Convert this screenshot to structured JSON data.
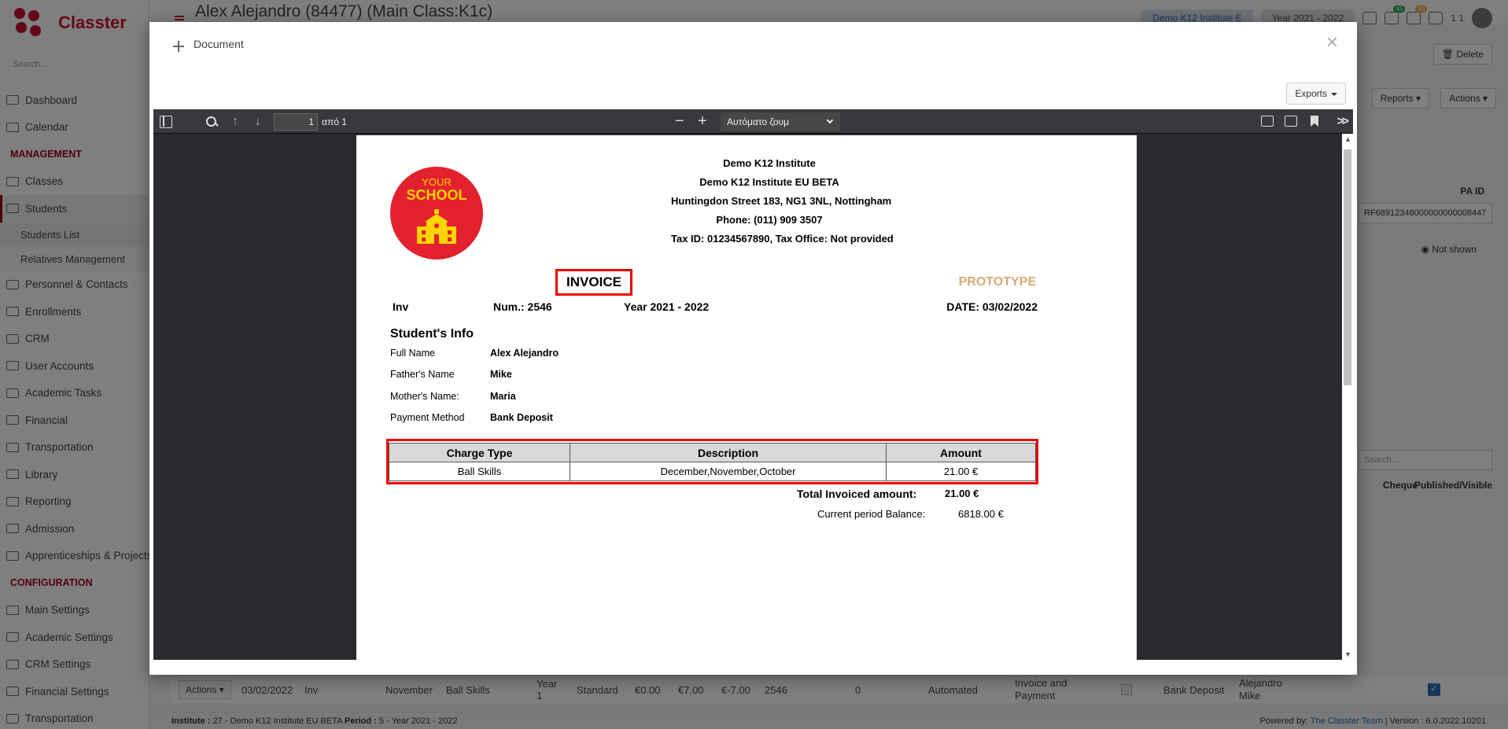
{
  "app": {
    "brand": "Classter",
    "page_title": "Alex Alejandro (84477) (Main Class:K1c)",
    "search_placeholder": "Search...",
    "institute_pill": "Demo K12 Institute E",
    "year_pill": "Year 2021 - 2022",
    "notif_counts": [
      "45",
      "36"
    ],
    "user_label": "1 1"
  },
  "sidebar": {
    "items": [
      {
        "label": "Dashboard",
        "type": "item"
      },
      {
        "label": "Calendar",
        "type": "item"
      },
      {
        "label": "MANAGEMENT",
        "type": "section"
      },
      {
        "label": "Classes",
        "type": "item"
      },
      {
        "label": "Students",
        "type": "active"
      },
      {
        "label": "Students List",
        "type": "sub-active"
      },
      {
        "label": "Relatives Management",
        "type": "sub"
      },
      {
        "label": "Personnel & Contacts",
        "type": "item"
      },
      {
        "label": "Enrollments",
        "type": "item"
      },
      {
        "label": "CRM",
        "type": "item"
      },
      {
        "label": "User Accounts",
        "type": "item"
      },
      {
        "label": "Academic Tasks",
        "type": "item"
      },
      {
        "label": "Financial",
        "type": "item"
      },
      {
        "label": "Transportation",
        "type": "item"
      },
      {
        "label": "Library",
        "type": "item"
      },
      {
        "label": "Reporting",
        "type": "item"
      },
      {
        "label": "Admission",
        "type": "item"
      },
      {
        "label": "Apprenticeships & Projects",
        "type": "item"
      },
      {
        "label": "CONFIGURATION",
        "type": "section"
      },
      {
        "label": "Main Settings",
        "type": "item"
      },
      {
        "label": "Academic Settings",
        "type": "item"
      },
      {
        "label": "CRM Settings",
        "type": "item"
      },
      {
        "label": "Financial Settings",
        "type": "item"
      },
      {
        "label": "Transportation",
        "type": "item"
      }
    ]
  },
  "background": {
    "delete_label": "Delete",
    "reports_label": "Reports",
    "actions_label": "Actions",
    "pa_id_label": "PA ID",
    "pa_id_value": "RF68912348000000000008447",
    "not_shown_label": "Not shown",
    "search_placeholder": "Search...",
    "col_cheque": "Cheque",
    "col_published": "Published/Visible",
    "row": {
      "actions": "Actions",
      "date": "03/02/2022",
      "type": "Inv",
      "month": "November",
      "charge": "Ball Skills",
      "year": "Year 1",
      "plan": "Standard",
      "v1": "€0.00",
      "v2": "€7.00",
      "v3": "€-7.00",
      "num": "2546",
      "zero": "0",
      "mode": "Automated",
      "kind": "Invoice and Payment",
      "method": "Bank Deposit",
      "person": "Alejandro Mike"
    },
    "footer_left_institute_label": "Institute :",
    "footer_left_institute": "27 - Demo K12 Institute EU BETA",
    "footer_left_period_label": "Period :",
    "footer_left_period": "5 - Year 2021 - 2022",
    "footer_powered": "Powered by:",
    "footer_team": "The Classter Team",
    "footer_version": "| Version : 6.0.2022.10201"
  },
  "modal": {
    "title": "Document",
    "exports_label": "Exports"
  },
  "viewer": {
    "page_number": "1",
    "page_of": "από 1",
    "zoom": "Αυτόματο ζουμ"
  },
  "invoice": {
    "logo_top": "YOUR",
    "logo_main": "SCHOOL",
    "institute_lines": [
      "Demo K12 Institute",
      "Demo K12 Institute EU BETA",
      "Huntingdon Street 183, NG1 3NL, Nottingham",
      "Phone: (011) 909 3507",
      "Tax ID: 01234567890, Tax Office: Not provided"
    ],
    "title": "INVOICE",
    "watermark": "PROTOTYPE",
    "inv_type": "Inv",
    "number": "Num.: 2546",
    "year": "Year 2021 - 2022",
    "date": "DATE: 03/02/2022",
    "student_heading": "Student's Info",
    "student_rows": [
      {
        "label": "Full Name",
        "value": "Alex Alejandro"
      },
      {
        "label": "Father's Name",
        "value": "Mike"
      },
      {
        "label": "Mother's Name:",
        "value": "Maria"
      },
      {
        "label": "Payment Method",
        "value": "Bank Deposit"
      }
    ],
    "charges_headers": [
      "Charge Type",
      "Description",
      "Amount"
    ],
    "charges_rows": [
      [
        "Ball Skills",
        "December,November,October",
        "21.00 €"
      ]
    ],
    "total_label": "Total Invoiced amount:",
    "total_value": "21.00 €",
    "balance_label": "Current period Balance:",
    "balance_value": "6818.00 €"
  }
}
